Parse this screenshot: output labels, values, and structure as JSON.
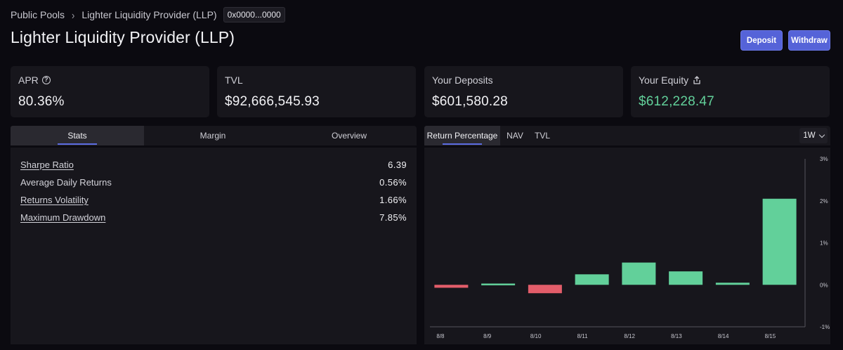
{
  "breadcrumb": {
    "root": "Public Pools",
    "separator": "›",
    "current": "Lighter Liquidity Provider (LLP)",
    "address": "0x0000...0000"
  },
  "page_title": "Lighter Liquidity Provider (LLP)",
  "actions": {
    "deposit": "Deposit",
    "withdraw": "Withdraw"
  },
  "cards": [
    {
      "label": "APR",
      "value": "80.36%",
      "icon": "info-icon"
    },
    {
      "label": "TVL",
      "value": "$92,666,545.93"
    },
    {
      "label": "Your Deposits",
      "value": "$601,580.28"
    },
    {
      "label": "Your Equity",
      "value": "$612,228.47",
      "icon": "share-icon"
    }
  ],
  "left_tabs": [
    "Stats",
    "Margin",
    "Overview"
  ],
  "stats": [
    {
      "label": "Sharpe Ratio",
      "value": "6.39"
    },
    {
      "label": "Average Daily Returns",
      "value": "0.56%"
    },
    {
      "label": "Returns Volatility",
      "value": "1.66%"
    },
    {
      "label": "Maximum Drawdown",
      "value": "7.85%"
    }
  ],
  "right_tabs": [
    "Return Percentage",
    "NAV",
    "TVL"
  ],
  "range": "1W",
  "colors": {
    "positive": "#62d09a",
    "negative": "#e35d6a",
    "accent": "#5563d8"
  },
  "chart_data": {
    "type": "bar",
    "categories": [
      "8/8",
      "8/9",
      "8/10",
      "8/11",
      "8/12",
      "8/13",
      "8/14",
      "8/15"
    ],
    "values": [
      -0.07,
      0.03,
      -0.2,
      0.25,
      0.53,
      0.32,
      0.05,
      2.05
    ],
    "xlabel": "",
    "ylabel": "",
    "ylim": [
      -1,
      3
    ],
    "yticks": [
      "3%",
      "2%",
      "1%",
      "0%",
      "-1%"
    ],
    "ytick_values": [
      3,
      2,
      1,
      0,
      -1
    ],
    "grid": false
  }
}
